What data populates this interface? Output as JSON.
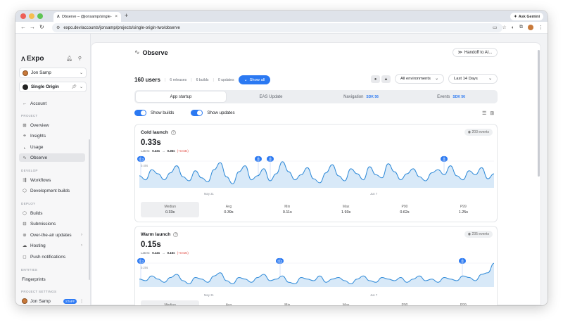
{
  "browser": {
    "tab_title": "Observe – @jonsamp/single-",
    "url": "expo.dev/accounts/jonsamp/projects/single-origin-two/observe",
    "ask_gemini": "Ask Gemini"
  },
  "sidebar": {
    "brand": "Expo",
    "account_name": "Jon Samp",
    "project_name": "Single Origin",
    "back_label": "Account",
    "sections": {
      "project": "PROJECT",
      "develop": "DEVELOP",
      "deploy": "DEPLOY",
      "entities": "ENTITIES",
      "project_settings": "PROJECT SETTINGS"
    },
    "items": {
      "overview": "Overview",
      "insights": "Insights",
      "usage": "Usage",
      "observe": "Observe",
      "workflows": "Workflows",
      "dev_builds": "Development builds",
      "builds": "Builds",
      "submissions": "Submissions",
      "ota": "Over-the-air updates",
      "hosting": "Hosting",
      "push": "Push notifications",
      "fingerprints": "Fingerprints"
    },
    "footer_user": "Jon Samp",
    "staff_badge": "STAFF"
  },
  "header": {
    "title": "Observe",
    "handoff": "Handoff to AI..."
  },
  "stats": {
    "users": "160 users",
    "releases": "6 releases",
    "builds": "6 builds",
    "updates": "0 updates",
    "show_all": "Show all"
  },
  "filters": {
    "environment": "All environments",
    "range": "Last 14 Days"
  },
  "segments": {
    "app_startup": "App startup",
    "eas_update": "EAS Update",
    "navigation": "Navigation",
    "events": "Events",
    "sdk_badge": "SDK 56"
  },
  "toggles": {
    "show_builds": "Show builds",
    "show_updates": "Show updates"
  },
  "cold": {
    "title": "Cold launch",
    "events": "203 events",
    "big_value": "0.33s",
    "latest_label": "Latest:",
    "latest_from": "0.33s",
    "arrow": "→",
    "latest_to": "0.36s",
    "delta": "(+0.03s)",
    "y_tick": "0.40s",
    "x_ticks": [
      "May 31",
      "Jun 7"
    ],
    "pins": [
      "3",
      "",
      "",
      ""
    ],
    "stats": [
      {
        "label": "Median",
        "value": "0.33s"
      },
      {
        "label": "Avg",
        "value": "0.39s"
      },
      {
        "label": "Min",
        "value": "0.11s"
      },
      {
        "label": "Max",
        "value": "1.93s"
      },
      {
        "label": "P90",
        "value": "0.62s"
      },
      {
        "label": "P99",
        "value": "1.25s"
      }
    ]
  },
  "warm": {
    "title": "Warm launch",
    "events": "235 events",
    "big_value": "0.15s",
    "latest_label": "Latest:",
    "latest_from": "0.14s",
    "arrow": "→",
    "latest_to": "0.16s",
    "delta": "(+0.02s)",
    "y_tick": "0.20s",
    "x_ticks": [
      "May 31",
      "Jun 7"
    ],
    "pins": [
      "2",
      "2",
      ""
    ],
    "stats": [
      {
        "label": "Median",
        "value": "0.15s"
      },
      {
        "label": "Avg",
        "value": "0.20s"
      },
      {
        "label": "Min",
        "value": "0.05s"
      },
      {
        "label": "Max",
        "value": "0.89s"
      },
      {
        "label": "P90",
        "value": "0.33s"
      },
      {
        "label": "P99",
        "value": "0.77s"
      }
    ]
  },
  "colors": {
    "accent": "#2b79f2",
    "line": "#2f8ad8",
    "area": "#d8e9f8",
    "delta": "#e0463d"
  },
  "chart_data": [
    {
      "type": "area",
      "title": "Cold launch",
      "x_ticks": [
        "May 31",
        "Jun 7"
      ],
      "y_tick": "0.40s",
      "series": [
        {
          "values": [
            0.34,
            0.3,
            0.4,
            0.36,
            0.3,
            0.37,
            0.44,
            0.33,
            0.29,
            0.39,
            0.32,
            0.28,
            0.4,
            0.47,
            0.33,
            0.26,
            0.38,
            0.44,
            0.3,
            0.34,
            0.41,
            0.29,
            0.36,
            0.48,
            0.38,
            0.3,
            0.35,
            0.42,
            0.31,
            0.27,
            0.37,
            0.45,
            0.34,
            0.29,
            0.41,
            0.36,
            0.3,
            0.43,
            0.35,
            0.32,
            0.46,
            0.38,
            0.3,
            0.36,
            0.41,
            0.33,
            0.29,
            0.37,
            0.4,
            0.35,
            0.44,
            0.34,
            0.3,
            0.39,
            0.35,
            0.42,
            0.31,
            0.36
          ]
        }
      ]
    },
    {
      "type": "area",
      "title": "Warm launch",
      "x_ticks": [
        "May 31",
        "Jun 7"
      ],
      "y_tick": "0.20s",
      "series": [
        {
          "values": [
            0.15,
            0.14,
            0.17,
            0.15,
            0.13,
            0.16,
            0.18,
            0.14,
            0.12,
            0.16,
            0.15,
            0.13,
            0.17,
            0.19,
            0.14,
            0.12,
            0.16,
            0.15,
            0.13,
            0.16,
            0.18,
            0.14,
            0.15,
            0.17,
            0.13,
            0.12,
            0.16,
            0.15,
            0.14,
            0.17,
            0.13,
            0.15,
            0.16,
            0.14,
            0.12,
            0.15,
            0.17,
            0.14,
            0.13,
            0.16,
            0.15,
            0.14,
            0.16,
            0.13,
            0.15,
            0.17,
            0.14,
            0.15,
            0.13,
            0.16,
            0.15,
            0.14,
            0.17,
            0.16,
            0.14,
            0.18,
            0.19,
            0.25
          ]
        }
      ]
    }
  ]
}
